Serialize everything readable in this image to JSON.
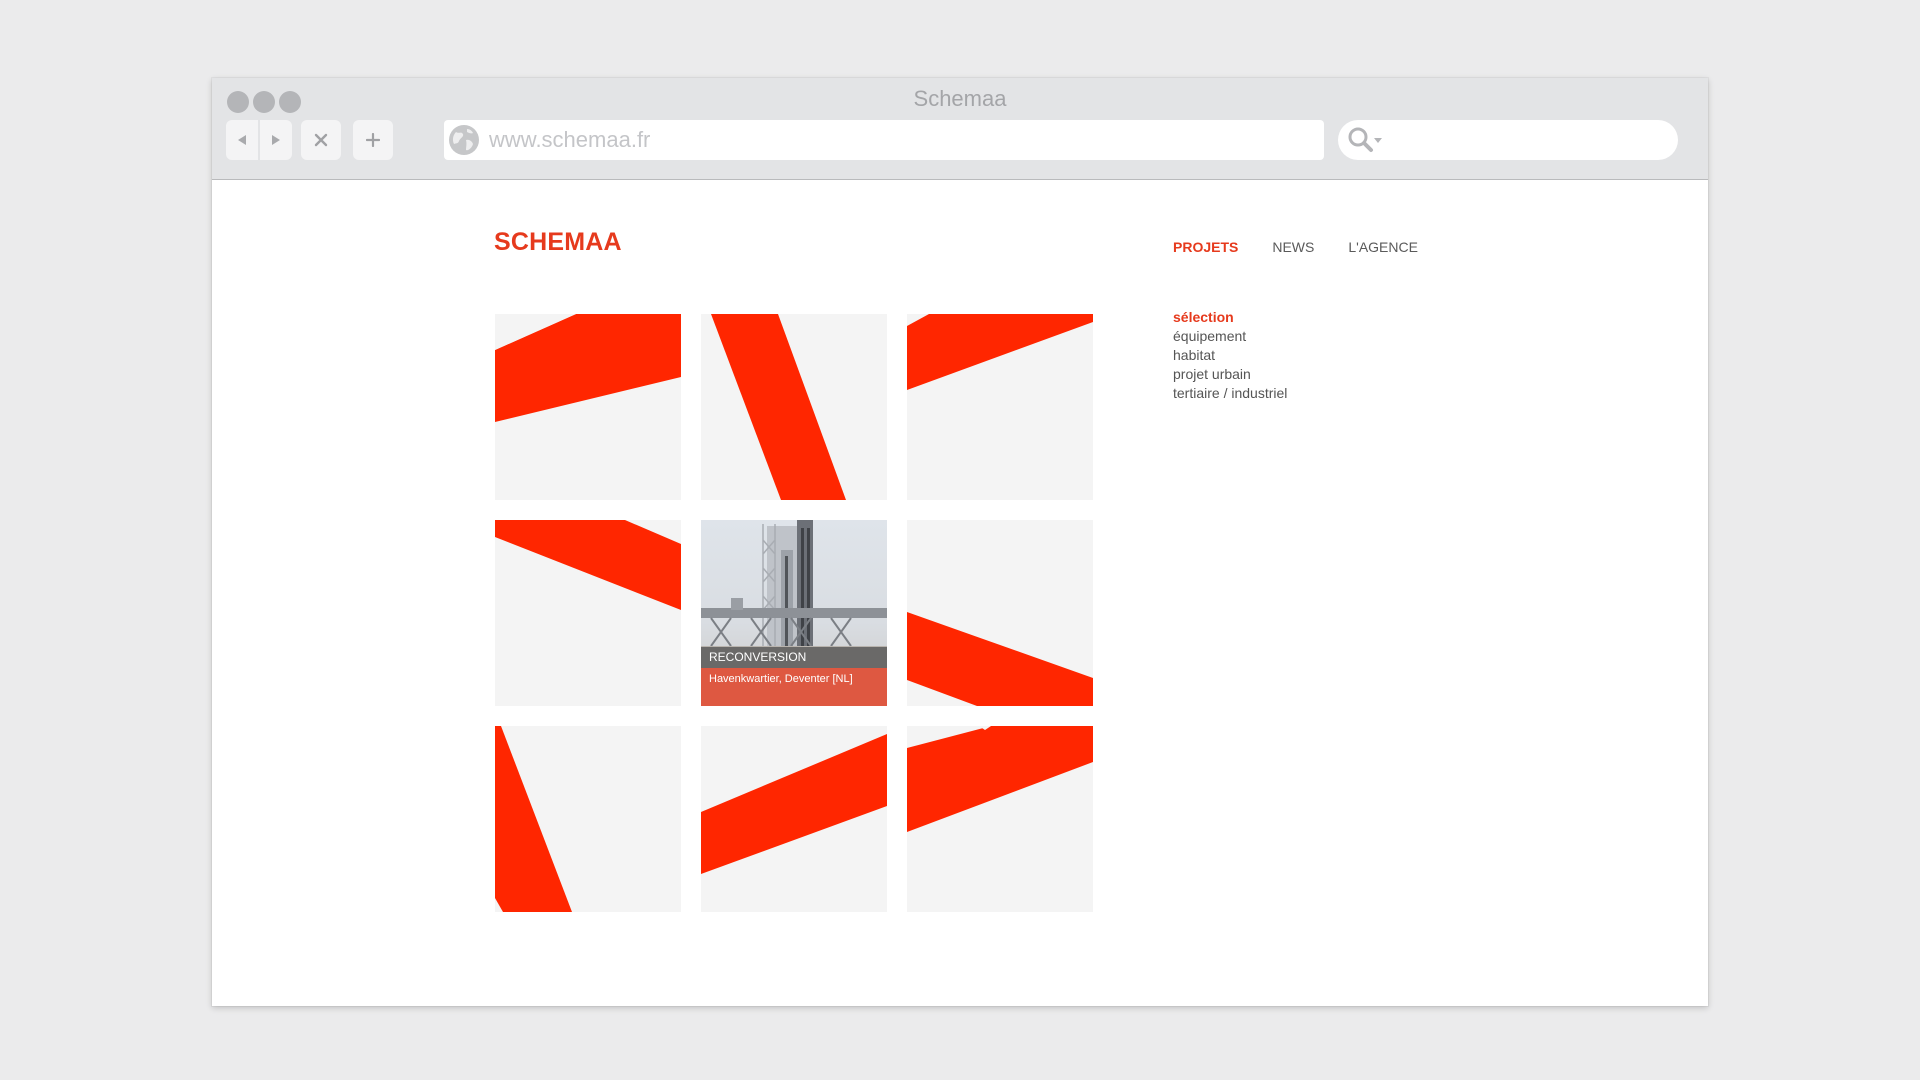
{
  "window": {
    "title": "Schemaa",
    "url": "www.schemaa.fr",
    "search_placeholder": ""
  },
  "toolbar": {
    "back_icon": "triangle-left",
    "forward_icon": "triangle-right",
    "stop_icon": "x",
    "new_tab_icon": "plus",
    "globe_icon": "globe",
    "search_icon": "magnifier"
  },
  "site": {
    "logo": "SCHEMAA",
    "brand_color": "#e63a1d",
    "nav": [
      {
        "label": "PROJETS",
        "active": true
      },
      {
        "label": "NEWS",
        "active": false
      },
      {
        "label": "L'AGENCE",
        "active": false
      }
    ],
    "categories": [
      {
        "label": "sélection",
        "active": true
      },
      {
        "label": "équipement",
        "active": false
      },
      {
        "label": "habitat",
        "active": false
      },
      {
        "label": "projet urbain",
        "active": false
      },
      {
        "label": "tertiaire / industriel",
        "active": false
      }
    ]
  },
  "grid": {
    "featured": {
      "category": "RECONVERSION",
      "title": "Havenkwartier, Deventer [NL]"
    }
  }
}
